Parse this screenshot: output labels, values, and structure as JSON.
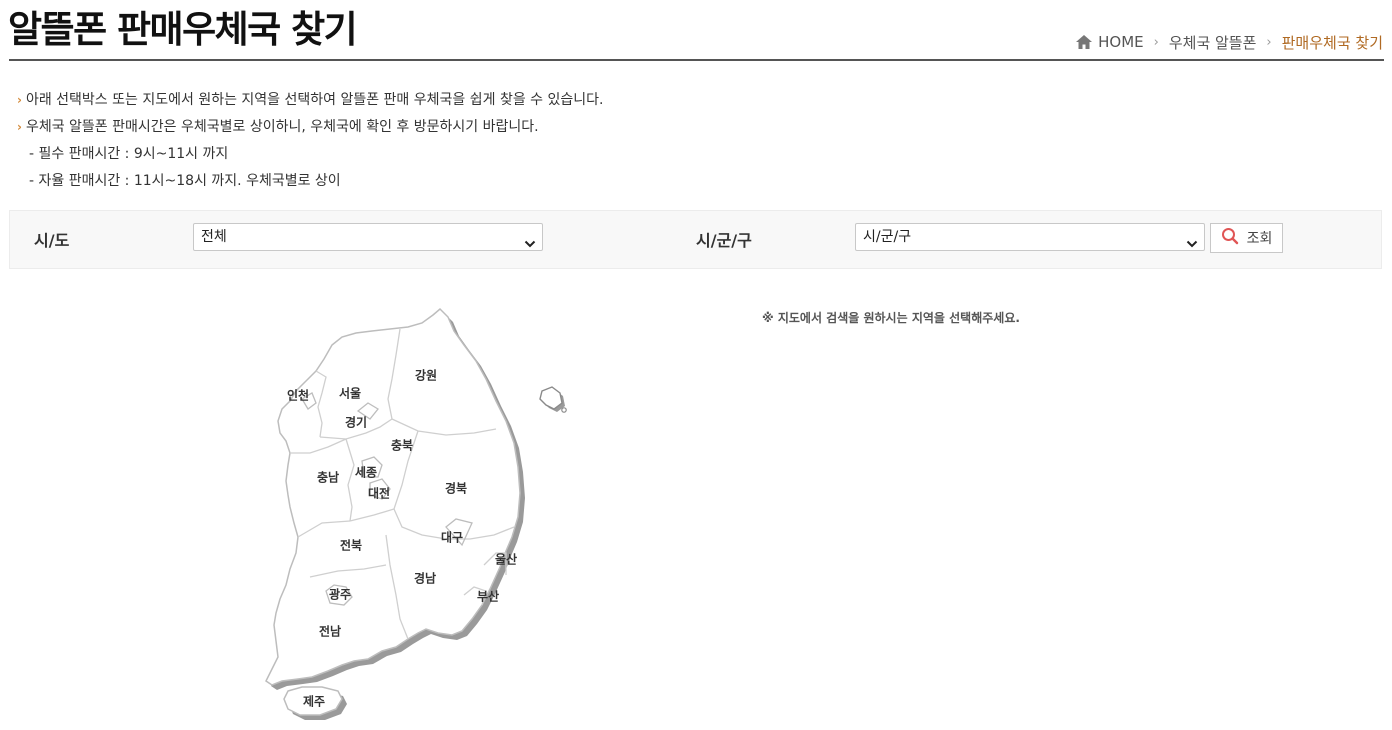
{
  "page": {
    "title": "알뜰폰 판매우체국 찾기"
  },
  "breadcrumb": {
    "icon": "home-icon",
    "home": "HOME",
    "level1": "우체국 알뜰폰",
    "current": "판매우체국 찾기"
  },
  "notes": {
    "line1": "아래 선택박스 또는 지도에서 원하는 지역을 선택하여 알뜰폰 판매 우체국을 쉽게 찾을 수 있습니다.",
    "line2": "우체국 알뜰폰 판매시간은 우체국별로 상이하니, 우체국에 확인 후 방문하시기 바랍니다.",
    "line3": "- 필수 판매시간 :  9시~11시 까지",
    "line4": "- 자율 판매시간 : 11시~18시 까지. 우체국별로 상이"
  },
  "search": {
    "sido_label": "시/도",
    "sido_value": "전체",
    "sigungu_label": "시/군/구",
    "sigungu_value": "시/군/구",
    "button_label": "조회",
    "button_icon": "search-icon"
  },
  "map": {
    "hint": "※ 지도에서 검색을 원하시는 지역을 선택해주세요.",
    "regions": {
      "incheon": "인천",
      "seoul": "서울",
      "gyeonggi": "경기",
      "gangwon": "강원",
      "chungbuk": "충북",
      "chungnam": "충남",
      "sejong": "세종",
      "daejeon": "대전",
      "gyeongbuk": "경북",
      "daegu": "대구",
      "jeonbuk": "전북",
      "ulsan": "울산",
      "gyeongnam": "경남",
      "busan": "부산",
      "gwangju": "광주",
      "jeonnam": "전남",
      "jeju": "제주"
    }
  },
  "colors": {
    "accent": "#b06a23",
    "bullet": "#d48b3c",
    "search_icon": "#e05555"
  }
}
